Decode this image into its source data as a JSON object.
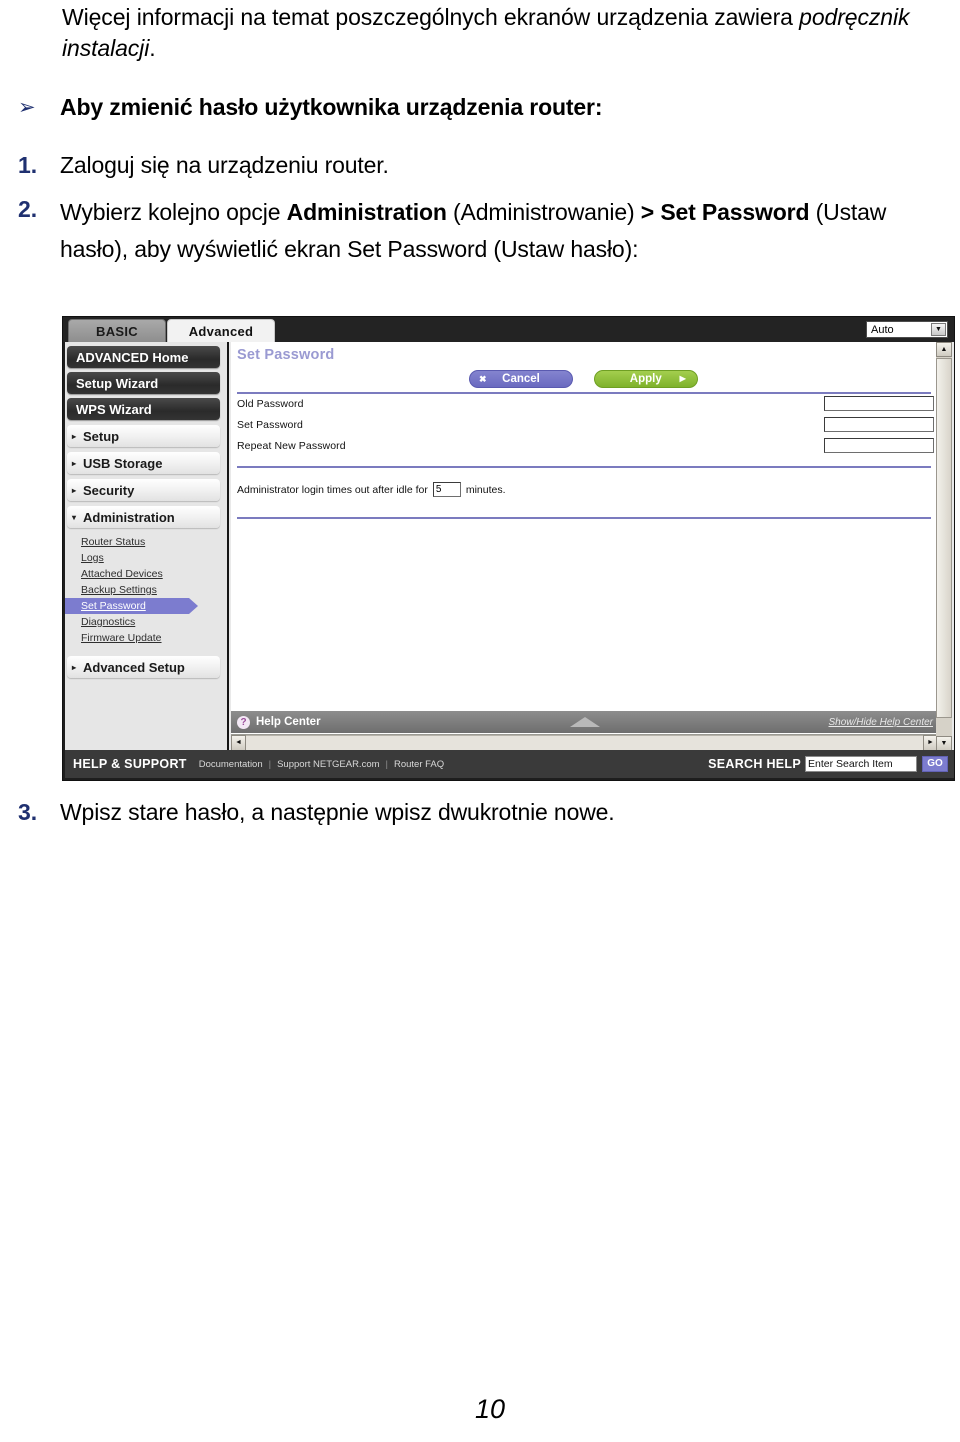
{
  "document": {
    "intro_line1": "Więcej informacji na temat poszczególnych ekranów urządzenia",
    "intro_line2_plain": "zawiera ",
    "intro_line2_italic": "podręcznik instalacji",
    "intro_line2_tail": ".",
    "bullet_marker": "➢",
    "heading": "Aby zmienić hasło użytkownika urządzenia router:",
    "steps": [
      {
        "marker": "1.",
        "text": "Zaloguj się na urządzeniu router."
      },
      {
        "marker": "2.",
        "text": "Wybierz kolejno opcje Administration (Administrowanie) > Set Password (Ustaw hasło), aby wyświetlić ekran Set Password (Ustaw hasło):"
      },
      {
        "marker": "3.",
        "text": "Wpisz stare hasło, a następnie wpisz dwukrotnie nowe."
      }
    ],
    "step2_parts": {
      "a": "Wybierz kolejno opcje ",
      "b_bold": "Administration",
      "c": " (Administrowanie) ",
      "d_bold": "> Set Password",
      "e": " (Ustaw hasło), aby wyświetlić ekran Set Password (Ustaw hasło):"
    },
    "page_number": "10"
  },
  "screenshot": {
    "tabs": [
      {
        "label": "BASIC",
        "active": false
      },
      {
        "label": "Advanced",
        "active": true
      }
    ],
    "device_mode": {
      "value": "Auto",
      "chevron": "▼"
    },
    "sidebar": {
      "primary": [
        {
          "label": "ADVANCED Home",
          "style": "dark"
        },
        {
          "label": "Setup Wizard",
          "style": "dark"
        },
        {
          "label": "WPS Wizard",
          "style": "dark"
        }
      ],
      "groups": [
        {
          "label": "Setup",
          "caret": "▸",
          "expanded": false
        },
        {
          "label": "USB Storage",
          "caret": "▸",
          "expanded": false
        },
        {
          "label": "Security",
          "caret": "▸",
          "expanded": false
        },
        {
          "label": "Administration",
          "caret": "▾",
          "expanded": true
        }
      ],
      "administration_items": [
        {
          "label": "Router Status",
          "selected": false
        },
        {
          "label": "Logs",
          "selected": false
        },
        {
          "label": "Attached Devices",
          "selected": false
        },
        {
          "label": "Backup Settings",
          "selected": false
        },
        {
          "label": "Set Password",
          "selected": true
        },
        {
          "label": "Diagnostics",
          "selected": false
        },
        {
          "label": "Firmware Update",
          "selected": false
        }
      ],
      "advanced_setup": {
        "label": "Advanced Setup",
        "caret": "▸"
      }
    },
    "content": {
      "page_title": "Set Password",
      "buttons": {
        "cancel": {
          "label": "Cancel",
          "glyph": "✖",
          "color": "#6a6ac0"
        },
        "apply": {
          "label": "Apply",
          "glyph": "▶",
          "color": "#7fb22c"
        }
      },
      "fields": [
        {
          "label": "Old Password",
          "value": ""
        },
        {
          "label": "Set Password",
          "value": ""
        },
        {
          "label": "Repeat New Password",
          "value": ""
        }
      ],
      "timeout": {
        "prefix": "Administrator login times out after idle for",
        "value": "5",
        "suffix": "minutes."
      }
    },
    "help_bar": {
      "icon": "?",
      "label": "Help Center",
      "toggle": "Show/Hide Help Center",
      "chevron_up": "▲"
    },
    "scrollbars": {
      "v_up": "▲",
      "v_down": "▼",
      "h_left": "◄",
      "h_right": "►"
    },
    "footer": {
      "title": "HELP & SUPPORT",
      "links": [
        "Documentation",
        "Support NETGEAR.com",
        "Router FAQ"
      ],
      "separator": "|",
      "search_label": "SEARCH HELP",
      "search_placeholder": "Enter Search Item",
      "go_label": "GO"
    },
    "accent_colors": {
      "rule": "#7b7bbf",
      "selected_nav": "#7c7ccf",
      "page_title": "#9a9ad2",
      "apply": "#7fb22c",
      "marker": "#1f3070"
    }
  }
}
